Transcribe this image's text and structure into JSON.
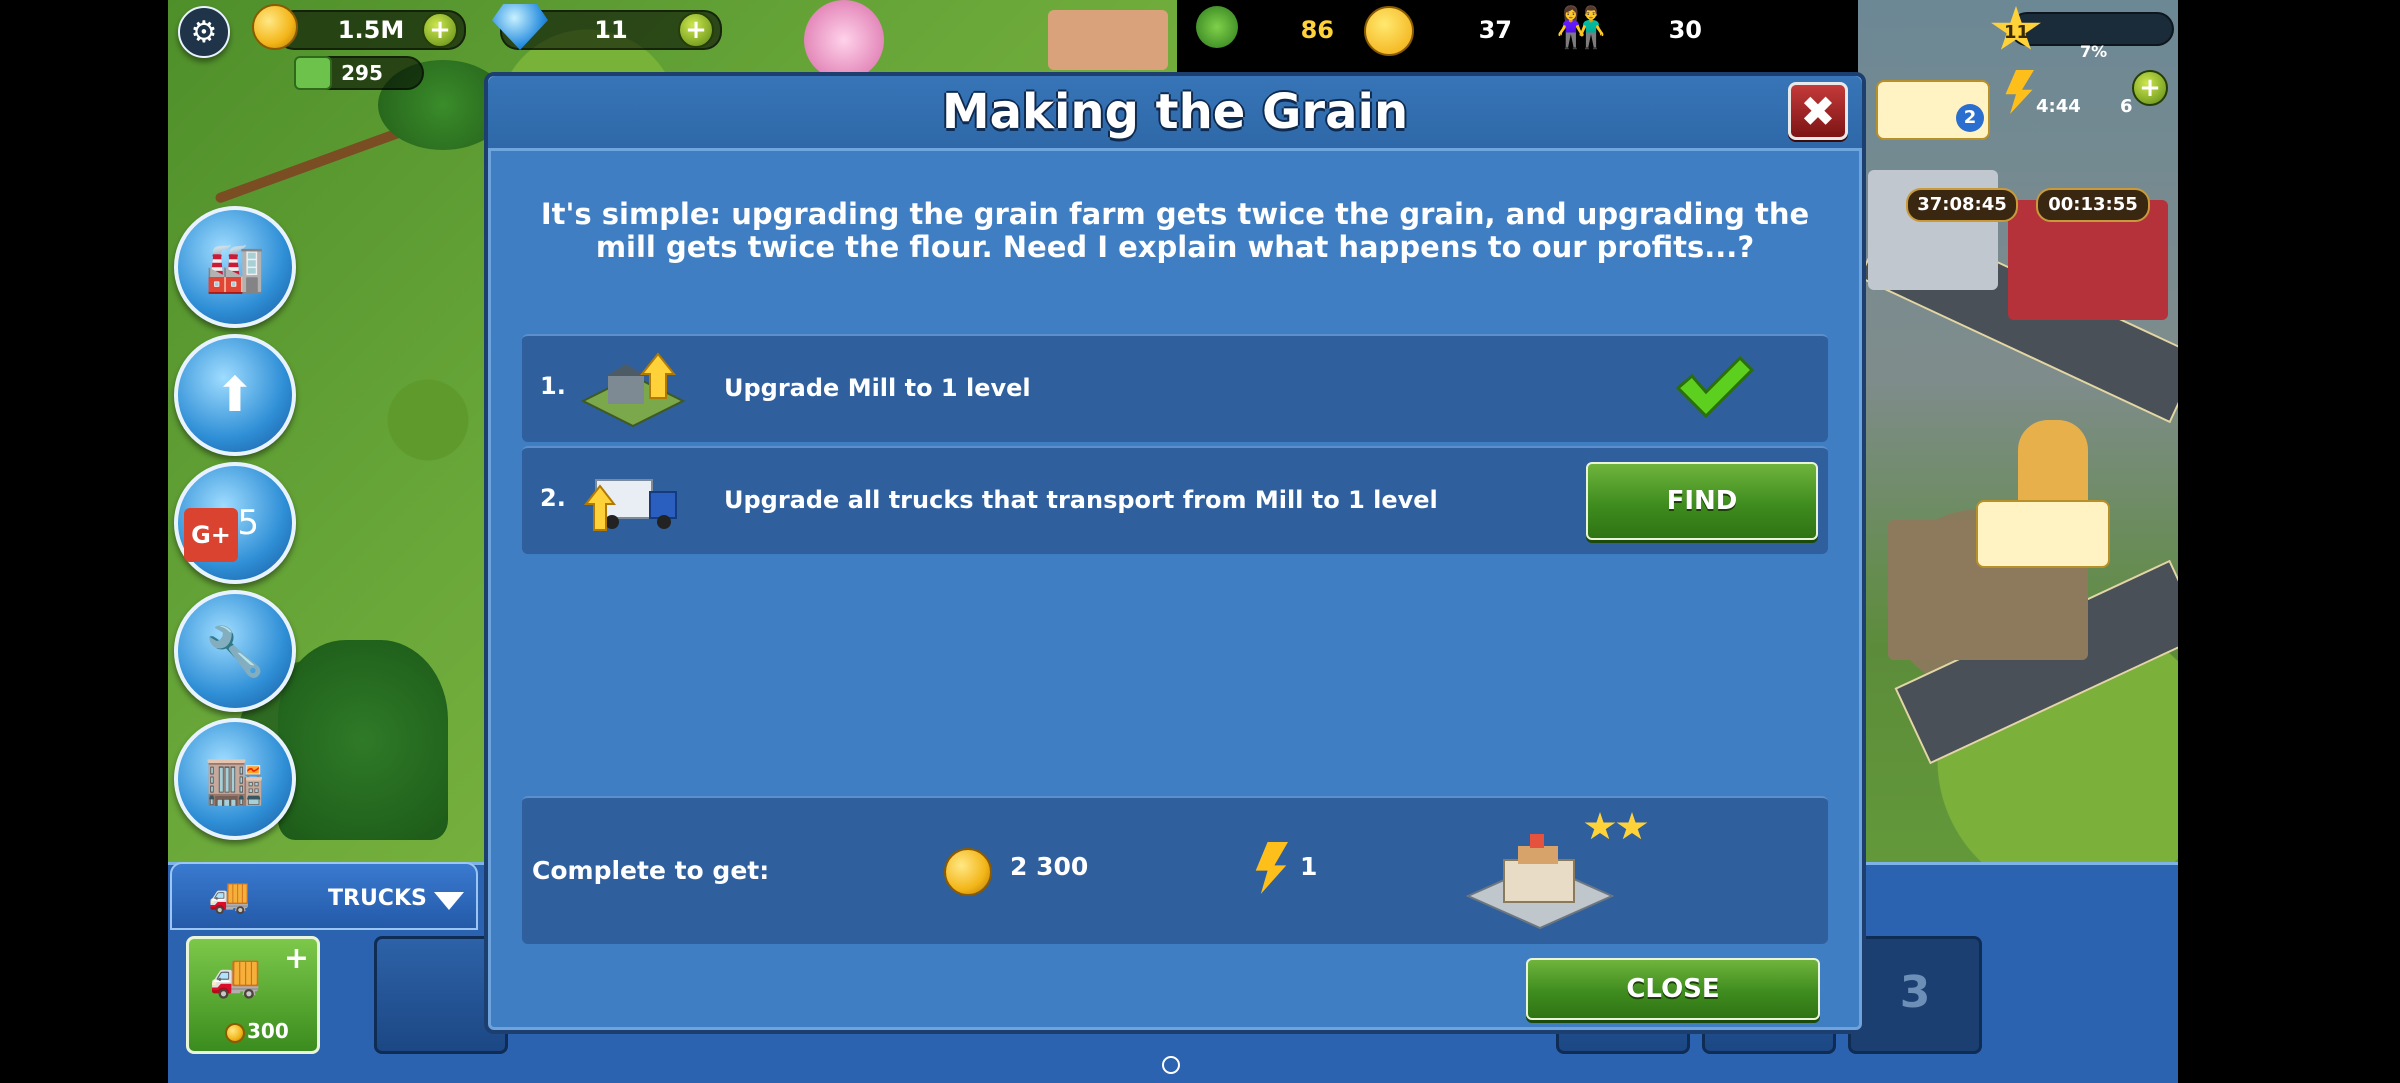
{
  "top_bar": {
    "coins": "1.5M",
    "cash": "295",
    "gems": "11",
    "trees": "86",
    "happiness": "37",
    "population": "30",
    "level": "11",
    "level_progress": "7%",
    "energy_timer": "4:44",
    "energy_count": "6"
  },
  "right_panel": {
    "truck_badge": "2",
    "timer_1": "37:08:45",
    "timer_2": "00:13:55"
  },
  "trucks_panel": {
    "label": "TRUCKS",
    "buy_price": "300",
    "slot_number": "3"
  },
  "dialog": {
    "title": "Making the Grain",
    "description": "It's simple: upgrading the grain farm gets twice the grain, and upgrading the mill gets twice the flour. Need I explain what happens to our profits...?",
    "tasks": [
      {
        "number": "1.",
        "text": "Upgrade Mill to 1 level",
        "completed": true
      },
      {
        "number": "2.",
        "text": "Upgrade all trucks that transport from Mill to 1 level",
        "button": "FIND"
      }
    ],
    "reward": {
      "label": "Complete to get:",
      "coins": "2 300",
      "energy": "1",
      "building_stars": 2
    },
    "close_label": "CLOSE"
  },
  "colors": {
    "dialog_bg": "#3f7ec3",
    "row_bg": "#2f5f9d",
    "button_green": "#3f8c1f",
    "close_red": "#c43a3a"
  }
}
